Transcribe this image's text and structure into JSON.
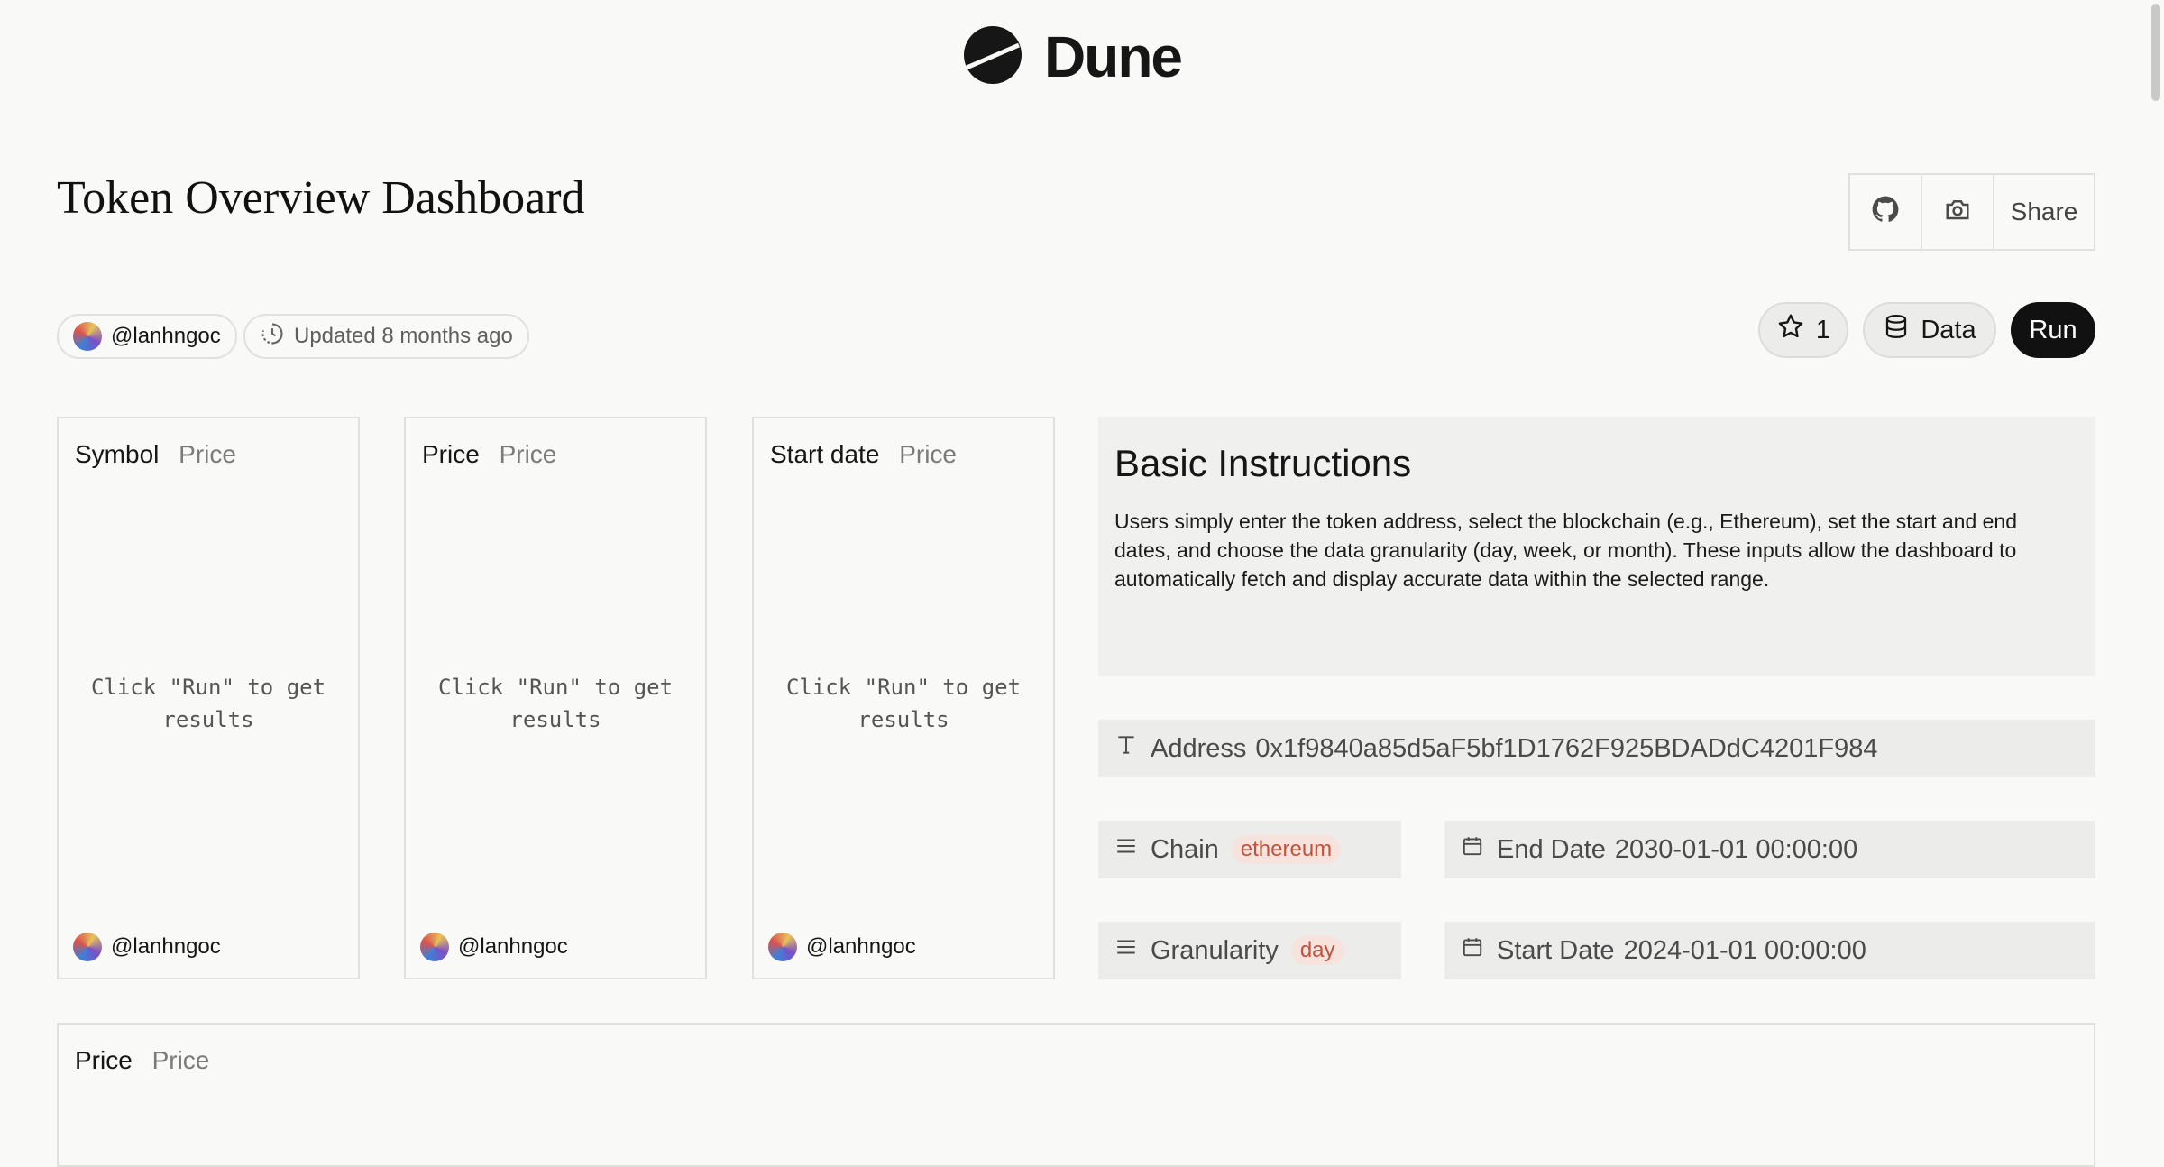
{
  "brand": {
    "name": "Dune",
    "logo_icon": "dune-logo-icon"
  },
  "page": {
    "title": "Token Overview Dashboard"
  },
  "toolbar": {
    "github_icon": "github-icon",
    "camera_icon": "camera-icon",
    "share_label": "Share"
  },
  "meta": {
    "author": "@lanhngoc",
    "updated": "Updated 8 months ago"
  },
  "actions": {
    "star_count": "1",
    "data_label": "Data",
    "run_label": "Run"
  },
  "cards": [
    {
      "title": "Symbol",
      "subtitle": "Price",
      "message": "Click \"Run\" to get results",
      "owner": "@lanhngoc"
    },
    {
      "title": "Price",
      "subtitle": "Price",
      "message": "Click \"Run\" to get results",
      "owner": "@lanhngoc"
    },
    {
      "title": "Start date",
      "subtitle": "Price",
      "message": "Click \"Run\" to get results",
      "owner": "@lanhngoc"
    }
  ],
  "instructions": {
    "heading": "Basic Instructions",
    "body": "Users simply enter the token address, select the blockchain (e.g., Ethereum), set the start and end dates, and choose the data granularity (day, week, or month). These inputs allow the dashboard to automatically fetch and display accurate data within the selected range."
  },
  "params": {
    "address": {
      "label": "Address",
      "value": "0x1f9840a85d5aF5bf1D1762F925BDADdC4201F984"
    },
    "chain": {
      "label": "Chain",
      "value": "ethereum"
    },
    "end_date": {
      "label": "End Date",
      "value": "2030-01-01 00:00:00"
    },
    "granularity": {
      "label": "Granularity",
      "value": "day"
    },
    "start_date": {
      "label": "Start Date",
      "value": "2024-01-01 00:00:00"
    }
  },
  "bottom_card": {
    "title": "Price",
    "subtitle": "Price"
  },
  "colors": {
    "background": "#f9f9f7",
    "run_button": "#111111",
    "tag_text": "#c4513a",
    "tag_bg": "#f6e3de"
  }
}
